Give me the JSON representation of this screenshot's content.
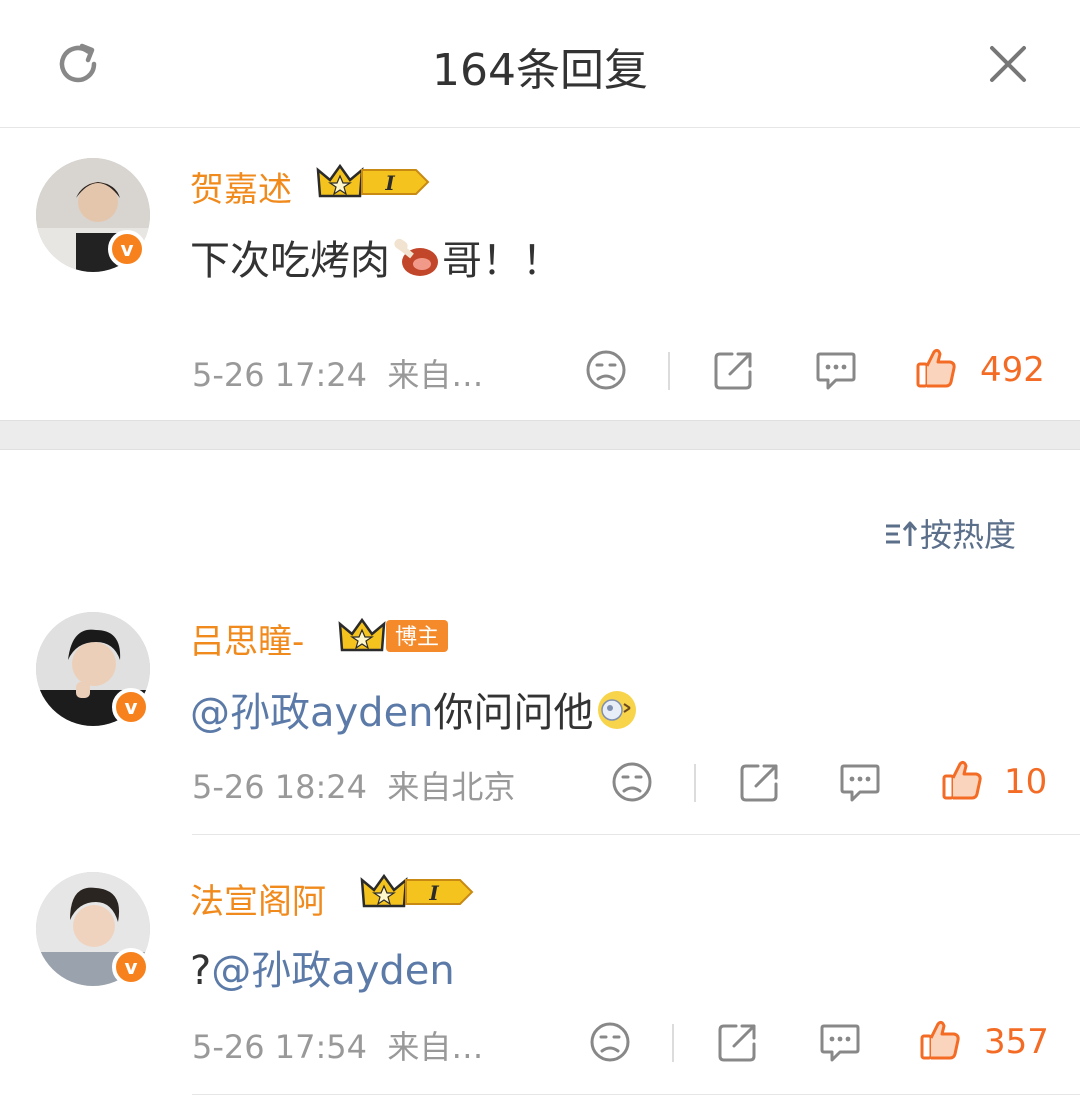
{
  "header": {
    "title": "164条回复"
  },
  "colors": {
    "username": "#f08a1d",
    "mention": "#5b7aa8",
    "meta": "#999999",
    "like": "#f36b24",
    "vbadge": "#f7821d"
  },
  "sort": {
    "label": "按热度"
  },
  "comments": [
    {
      "username": "贺嘉述",
      "badge": "I",
      "text": "下次吃烤肉",
      "text_after": "哥！！",
      "emoji": "meat-emoji",
      "time": "5-26 17:24",
      "source": "来自…",
      "likes": "492"
    },
    {
      "username": "吕思瞳-",
      "badge": "博主",
      "mention": "@孙政ayden",
      "text": "你问问他",
      "emoji": "dizzy-face-emoji",
      "time": "5-26 18:24",
      "source": "来自北京",
      "likes": "10"
    },
    {
      "username": "法宣阁阿",
      "badge": "I",
      "prefix": "?",
      "mention": "@孙政ayden",
      "time": "5-26 17:54",
      "source": "来自…",
      "likes": "357"
    }
  ]
}
